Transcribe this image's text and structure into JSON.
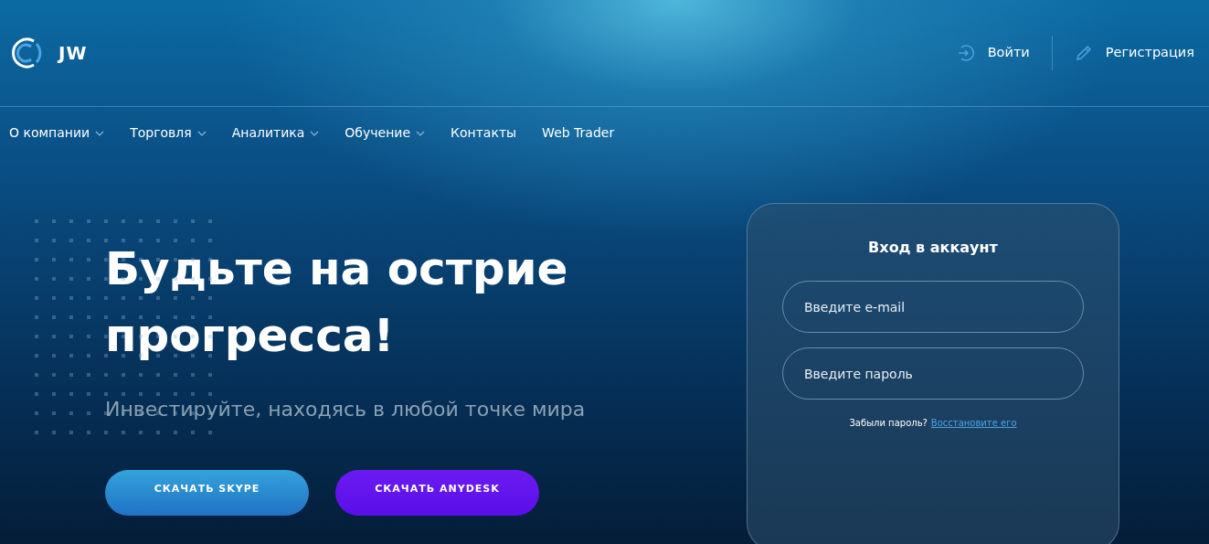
{
  "brand": {
    "name": "JW"
  },
  "header_links": [
    {
      "kind": "login",
      "label": "Войти"
    },
    {
      "kind": "register",
      "label": "Регистрация"
    }
  ],
  "nav": [
    {
      "label": "О компании",
      "has_dropdown": true
    },
    {
      "label": "Торговля",
      "has_dropdown": true
    },
    {
      "label": "Аналитика",
      "has_dropdown": true
    },
    {
      "label": "Обучение",
      "has_dropdown": true
    },
    {
      "label": "Контакты",
      "has_dropdown": false
    },
    {
      "label": "Web Trader",
      "has_dropdown": false
    }
  ],
  "hero": {
    "title": "Будьте на острие прогресса!",
    "subtitle": "Инвестируйте, находясь в любой точке мира",
    "buttons": [
      {
        "label": "СКАЧАТЬ SKYPE",
        "kind": "skype"
      },
      {
        "label": "СКАЧАТЬ ANYDESK",
        "kind": "anydesk"
      }
    ]
  },
  "login_card": {
    "title": "Вход в аккаунт",
    "fields": [
      {
        "placeholder": "Введите e-mail"
      },
      {
        "placeholder": "Введите пароль"
      }
    ],
    "forgot_text": "Забыли пароль?",
    "restore_link": "Восстановите его"
  }
}
